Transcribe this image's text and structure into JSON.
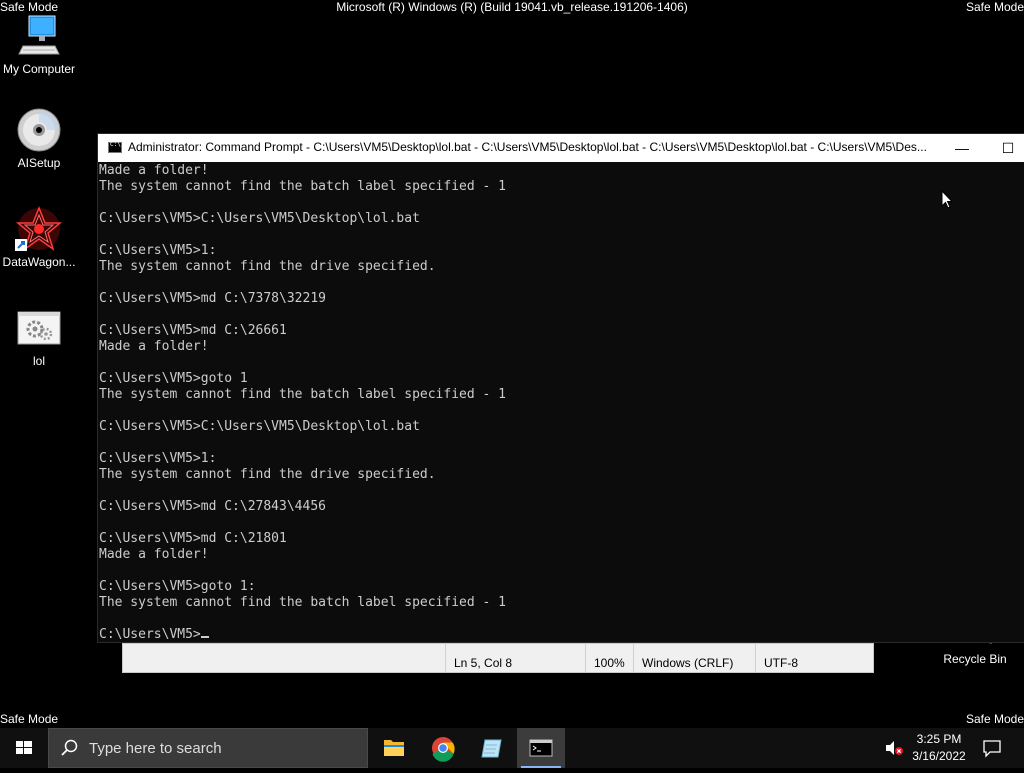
{
  "system": {
    "safe_mode_label": "Safe Mode",
    "build_text": "Microsoft (R) Windows (R) (Build 19041.vb_release.191206-1406)"
  },
  "desktop": {
    "icons": [
      {
        "label": "My Computer",
        "icon": "computer-icon"
      },
      {
        "label": "AISetup",
        "icon": "cd-disc-icon"
      },
      {
        "label": "DataWagon...",
        "icon": "datawagon-icon"
      },
      {
        "label": "lol",
        "icon": "batch-file-icon"
      },
      {
        "label": "Recycle Bin",
        "icon": "recycle-bin-icon"
      }
    ]
  },
  "cmd": {
    "title": "Administrator: Command Prompt - C:\\Users\\VM5\\Desktop\\lol.bat - C:\\Users\\VM5\\Desktop\\lol.bat - C:\\Users\\VM5\\Desktop\\lol.bat - C:\\Users\\VM5\\Des...",
    "minimize": "—",
    "maximize": "☐",
    "output": "Made a folder!\nThe system cannot find the batch label specified - 1\n\nC:\\Users\\VM5>C:\\Users\\VM5\\Desktop\\lol.bat\n\nC:\\Users\\VM5>1:\nThe system cannot find the drive specified.\n\nC:\\Users\\VM5>md C:\\7378\\32219\n\nC:\\Users\\VM5>md C:\\26661\nMade a folder!\n\nC:\\Users\\VM5>goto 1\nThe system cannot find the batch label specified - 1\n\nC:\\Users\\VM5>C:\\Users\\VM5\\Desktop\\lol.bat\n\nC:\\Users\\VM5>1:\nThe system cannot find the drive specified.\n\nC:\\Users\\VM5>md C:\\27843\\4456\n\nC:\\Users\\VM5>md C:\\21801\nMade a folder!\n\nC:\\Users\\VM5>goto 1:\nThe system cannot find the batch label specified - 1\n\nC:\\Users\\VM5>"
  },
  "notepad": {
    "position": "Ln 5, Col 8",
    "zoom": "100%",
    "line_ending": "Windows (CRLF)",
    "encoding": "UTF-8"
  },
  "taskbar": {
    "search_placeholder": "Type here to search",
    "time": "3:25 PM",
    "date": "3/16/2022"
  }
}
